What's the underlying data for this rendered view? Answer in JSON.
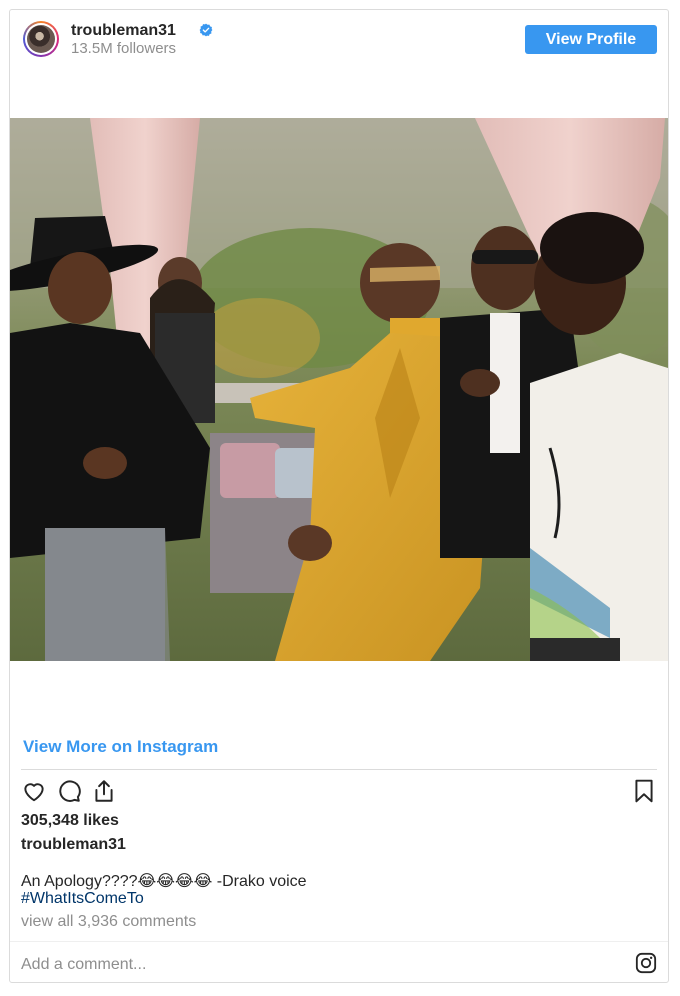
{
  "header": {
    "username": "troubleman31",
    "followers": "13.5M followers",
    "view_profile_label": "View Profile"
  },
  "post": {
    "view_more_label": "View More on Instagram",
    "likes": "305,348 likes",
    "owner": "troubleman31",
    "caption": "An Apology????😂😂😂😂 -Drako voice",
    "hashtag": "#WhatItsComeTo",
    "comments_link": "view all 3,936 comments"
  },
  "footer": {
    "add_comment_placeholder": "Add a comment..."
  },
  "icons": {
    "like": "heart-icon",
    "comment": "comment-icon",
    "share": "share-icon",
    "save": "bookmark-icon",
    "verified": "verified-badge-icon",
    "instagram": "instagram-logo-icon"
  },
  "colors": {
    "accent": "#3897f0",
    "hashtag": "#003569",
    "muted": "#8e8e8e",
    "text": "#262626",
    "border": "#dbdbdb"
  }
}
